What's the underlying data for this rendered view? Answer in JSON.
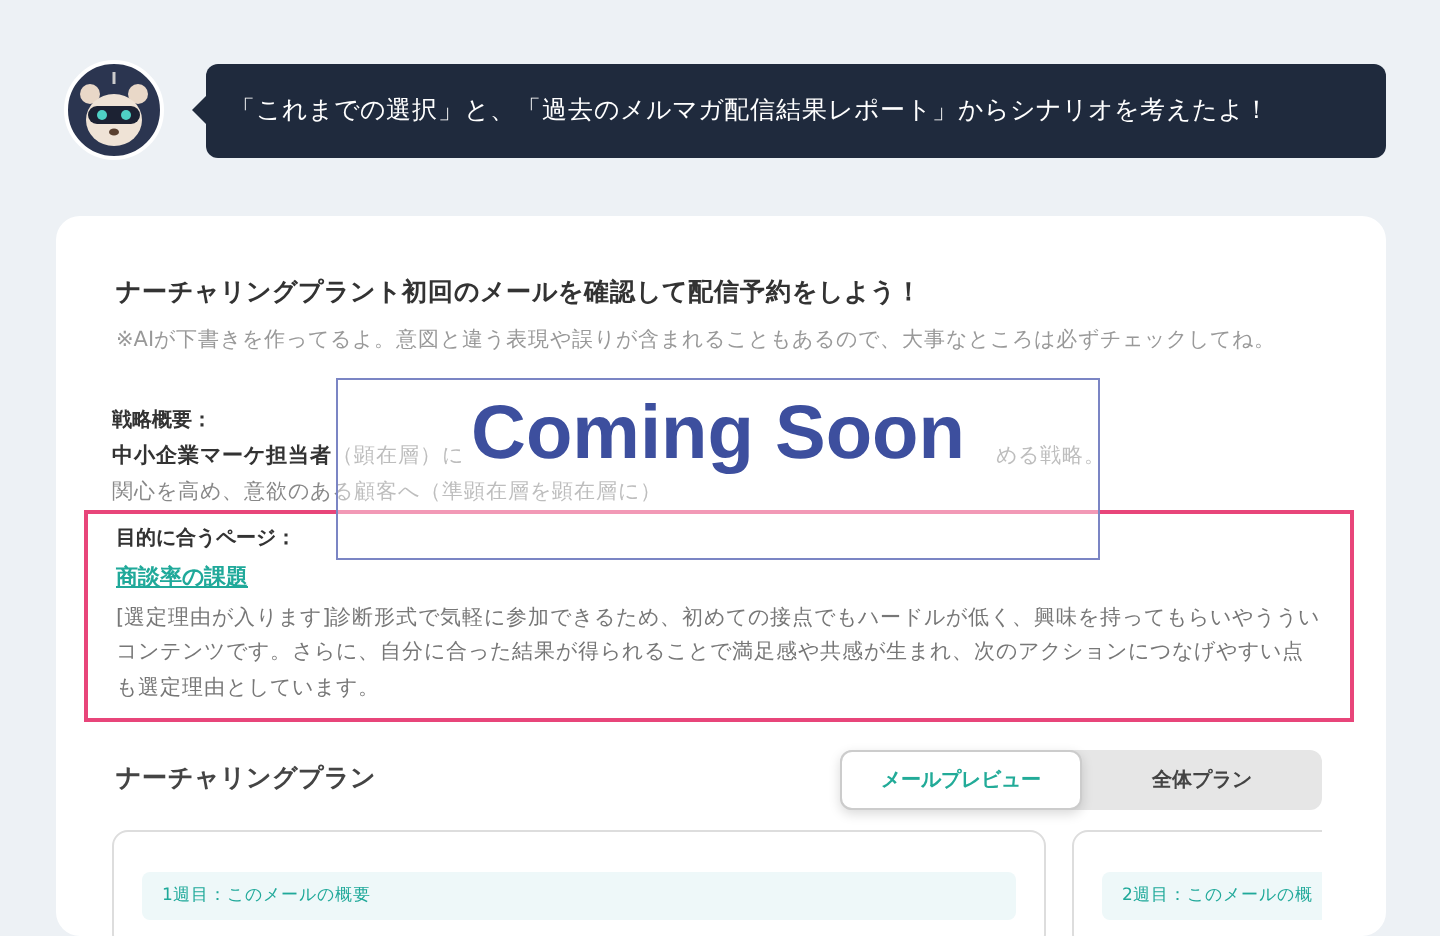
{
  "assistant_message": "「これまでの選択」と、「過去のメルマガ配信結果レポート」からシナリオを考えたよ！",
  "heading": "ナーチャリングプラント初回のメールを確認して配信予約をしよう！",
  "note": "※AIが下書きを作ってるよ。意図と違う表現や誤りが含まれることもあるので、大事なところは必ずチェックしてね。",
  "overlay": {
    "text": "Coming Soon"
  },
  "strategy": {
    "label": "戦略概要：",
    "target": "中小企業マーケ担当者",
    "line_1": "（顕在層）に",
    "line_1_end": "める戦略。",
    "line_2": "関心を高め、意欲のある顧客へ（準顕在層を顕在層に）"
  },
  "matching_page": {
    "label": "目的に合うページ：",
    "link": "商談率の課題",
    "reason": "[選定理由が入ります]診断形式で気軽に参加できるため、初めての接点でもハードルが低く、興味を持ってもらいやうういコンテンツです。さらに、自分に合った結果が得られることで満足感や共感が生まれ、次のアクションにつなげやすい点も選定理由としています。",
    "highlighted": true
  },
  "plan": {
    "title": "ナーチャリングプラン",
    "tabs": [
      {
        "label": "メールプレビュー",
        "selected": true
      },
      {
        "label": "全体プラン",
        "selected": false
      }
    ],
    "cards": [
      {
        "summary": "1週目：このメールの概要"
      },
      {
        "summary": "2週目：このメールの概"
      }
    ]
  }
}
